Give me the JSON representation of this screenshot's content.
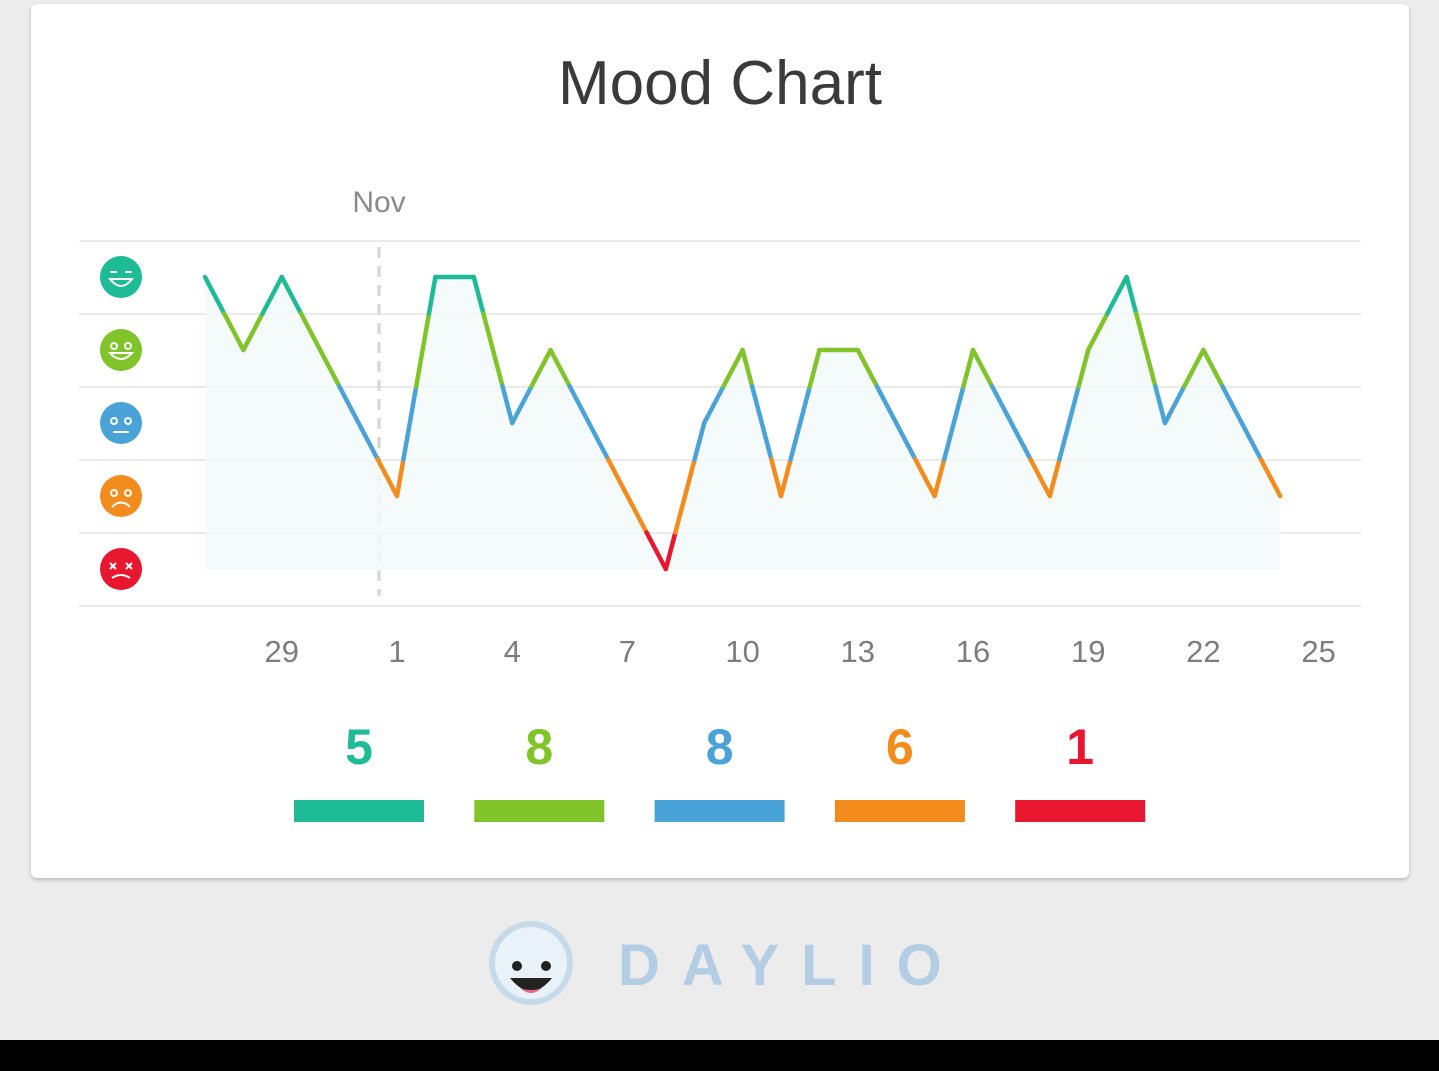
{
  "title": "Mood Chart",
  "brand": {
    "name": "DAYLIO",
    "icon": "daylio-logo-icon"
  },
  "moods": [
    {
      "level": 5,
      "icon": "rad-face-icon",
      "color": "#1dbb96"
    },
    {
      "level": 4,
      "icon": "good-face-icon",
      "color": "#80c42a"
    },
    {
      "level": 3,
      "icon": "meh-face-icon",
      "color": "#4aa3d8"
    },
    {
      "level": 2,
      "icon": "bad-face-icon",
      "color": "#f38c1c"
    },
    {
      "level": 1,
      "icon": "awful-face-icon",
      "color": "#e8172f"
    }
  ],
  "chart_data": {
    "type": "line",
    "title": "Mood Chart",
    "month_marker": {
      "label": "Nov",
      "x": "Nov 1"
    },
    "x_tick_labels": [
      "29",
      "1",
      "4",
      "7",
      "10",
      "13",
      "16",
      "19",
      "22",
      "25"
    ],
    "x_ticks": [
      "Oct 29",
      "Nov 1",
      "Nov 4",
      "Nov 7",
      "Nov 10",
      "Nov 13",
      "Nov 16",
      "Nov 19",
      "Nov 22",
      "Nov 25"
    ],
    "x": [
      "Oct 27",
      "Oct 28",
      "Oct 29",
      "Oct 30",
      "Oct 31",
      "Nov 1",
      "Nov 2",
      "Nov 3",
      "Nov 4",
      "Nov 5",
      "Nov 6",
      "Nov 7",
      "Nov 8",
      "Nov 9",
      "Nov 10",
      "Nov 11",
      "Nov 12",
      "Nov 13",
      "Nov 14",
      "Nov 15",
      "Nov 16",
      "Nov 17",
      "Nov 18",
      "Nov 19",
      "Nov 20",
      "Nov 21",
      "Nov 22",
      "Nov 23",
      "Nov 24"
    ],
    "y": [
      5,
      4,
      5,
      4,
      3,
      2,
      5,
      5,
      3,
      4,
      3,
      2,
      1,
      3,
      4,
      2,
      4,
      4,
      3,
      2,
      4,
      3,
      2,
      4,
      5,
      3,
      4,
      3,
      2
    ],
    "y_range": [
      1,
      5
    ],
    "grid": true,
    "legend": {
      "counts": [
        5,
        8,
        8,
        6,
        1
      ],
      "colors": [
        "#1dbb96",
        "#80c42a",
        "#4aa3d8",
        "#f38c1c",
        "#e8172f"
      ]
    }
  }
}
